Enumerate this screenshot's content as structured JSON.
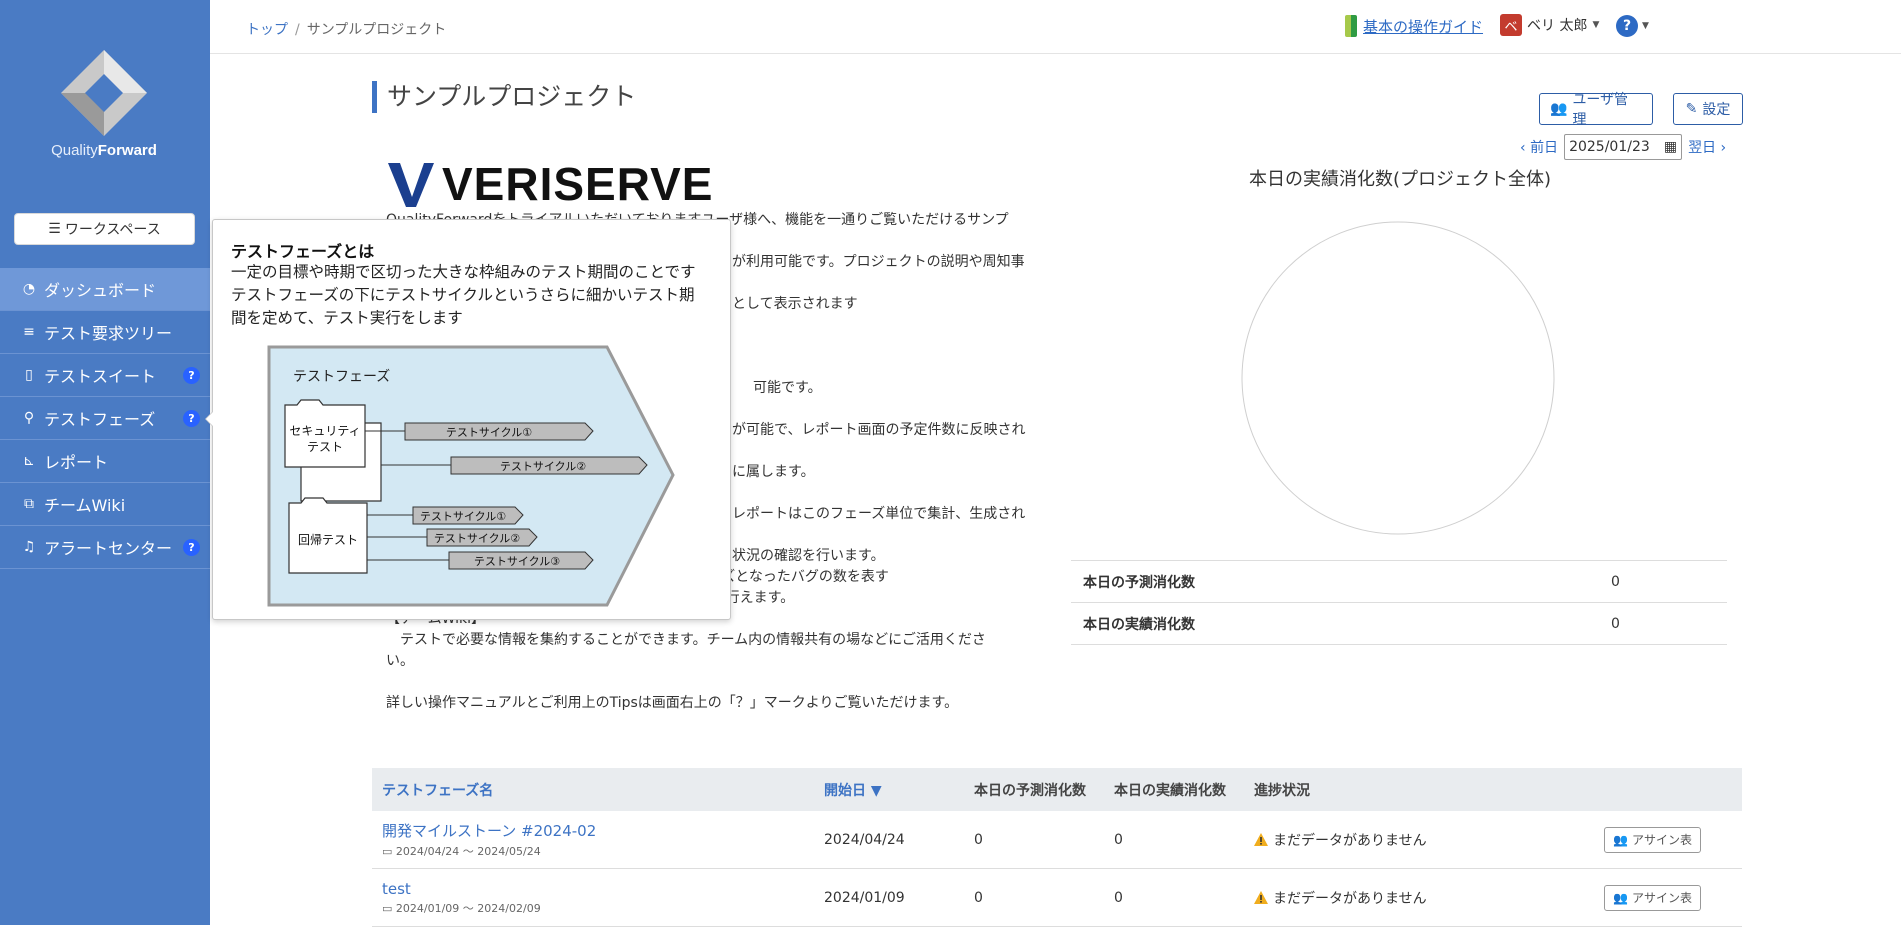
{
  "sidebar": {
    "logo": {
      "light": "Quality",
      "bold": "Forward"
    },
    "workspace_button": "ワークスペース",
    "items": [
      {
        "label": "ダッシュボード",
        "icon": "dashboard-icon",
        "active": true,
        "help": ""
      },
      {
        "label": "テスト要求ツリー",
        "icon": "tree-icon",
        "active": false,
        "help": ""
      },
      {
        "label": "テストスイート",
        "icon": "document-icon",
        "active": false,
        "help": "?"
      },
      {
        "label": "テストフェーズ",
        "icon": "stethoscope-icon",
        "active": false,
        "help": "?"
      },
      {
        "label": "レポート",
        "icon": "chart-icon",
        "active": false,
        "help": ""
      },
      {
        "label": "チームWiki",
        "icon": "copy-icon",
        "active": false,
        "help": ""
      },
      {
        "label": "アラートセンター",
        "icon": "bell-icon",
        "active": false,
        "help": "?"
      }
    ]
  },
  "header": {
    "breadcrumb": {
      "home": "トップ",
      "sep": "/",
      "current": "サンプルプロジェクト"
    },
    "guide_link": "基本の操作ガイド",
    "user": {
      "avatar": "ベ",
      "name": "ベリ 太郎"
    },
    "help": "?"
  },
  "main": {
    "title": "サンプルプロジェクト",
    "user_mgmt_button": "ユーザ管理",
    "settings_button": "設定",
    "prev_day": "前日",
    "next_day": "翌日",
    "date": "2025/01/23",
    "brand": "VERISERVE",
    "description": [
      "QualityForwardをトライアルいただいておりますユーザ様へ、機能を一通りご覧いただけるサンプ",
      "",
      "が利用可能です。プロジェクトの説明や周知事",
      "として表示されます",
      "",
      "",
      "可能です。",
      "",
      "が可能で、レポート画面の予定件数に反映され",
      "",
      "に属します。",
      "",
      "レポートはこのフェーズ単位で集計、生成され",
      "",
      "状況の確認を行います。",
      "　テスト実行の予定件数、実績数、バグの数、クローズとなったバグの数を表す",
      "　PB曲線や実績推移表の確認、およびエクスポートを行えます。",
      "【チームWiki】",
      "　テストで必要な情報を集約することができます。チーム内の情報共有の場などにご活用くださ",
      "い。",
      "",
      "詳しい操作マニュアルとご利用上のTipsは画面右上の「？」マークよりご覧いただけます。"
    ],
    "chart_title": "本日の実績消化数(プロジェクト全体)",
    "stats": [
      {
        "label": "本日の予測消化数",
        "value": "0"
      },
      {
        "label": "本日の実績消化数",
        "value": "0"
      }
    ]
  },
  "table": {
    "headers": {
      "name": "テストフェーズ名",
      "start": "開始日 ▼",
      "forecast": "本日の予測消化数",
      "actual": "本日の実績消化数",
      "progress": "進捗状況"
    },
    "rows": [
      {
        "name": "開発マイルストーン #2024-02",
        "period": "2024/04/24 〜 2024/05/24",
        "start": "2024/04/24",
        "forecast": "0",
        "actual": "0",
        "progress": "まだデータがありません",
        "assign": "アサイン表"
      },
      {
        "name": "test",
        "period": "2024/01/09 〜 2024/02/09",
        "start": "2024/01/09",
        "forecast": "0",
        "actual": "0",
        "progress": "まだデータがありません",
        "assign": "アサイン表"
      }
    ]
  },
  "popover": {
    "title": "テストフェーズとは",
    "lines": [
      "一定の目標や時期で区切った大きな枠組みのテスト期間のことです",
      "テストフェーズの下にテストサイクルというさらに細かいテスト期",
      "間を定めて、テスト実行をします"
    ],
    "diagram": {
      "phase_label": "テストフェーズ",
      "folder1": [
        "セキュリティ",
        "テスト"
      ],
      "folder2": "回帰テスト",
      "cycles_top": [
        "テストサイクル①",
        "テストサイクル②"
      ],
      "cycles_bottom": [
        "テストサイクル①",
        "テストサイクル②",
        "テストサイクル③"
      ]
    }
  },
  "colors": {
    "sidebar": "#4a7bc4",
    "accent": "#3d73c4",
    "avatar": "#c33b2e",
    "warning": "#f0ad1e"
  }
}
